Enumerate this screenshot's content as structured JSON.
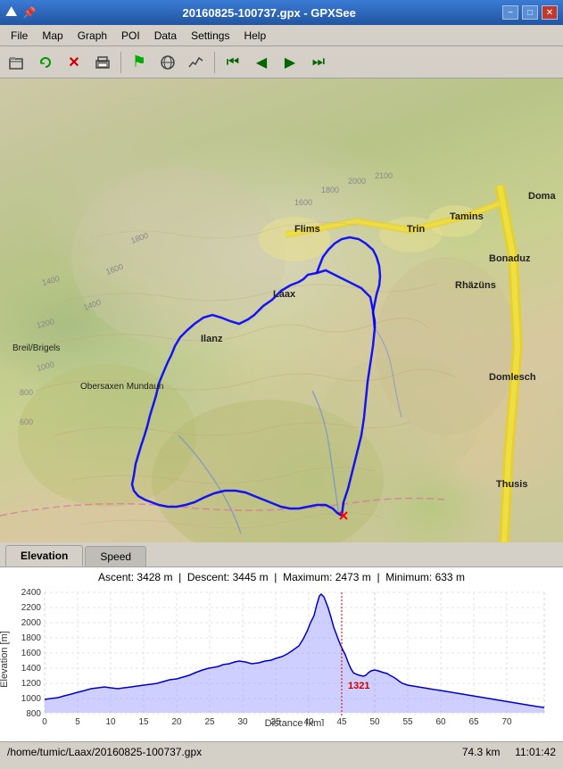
{
  "titlebar": {
    "icon": "⛰",
    "title": "20160825-100737.gpx - GPXSee",
    "minimize": "−",
    "maximize": "□",
    "close": "✕"
  },
  "menu": {
    "items": [
      "File",
      "Map",
      "Graph",
      "POI",
      "Data",
      "Settings",
      "Help"
    ]
  },
  "toolbar": {
    "buttons": [
      {
        "name": "open-button",
        "icon": "🗁",
        "title": "Open"
      },
      {
        "name": "reload-button",
        "icon": "↺",
        "title": "Reload"
      },
      {
        "name": "close-button",
        "icon": "✕",
        "title": "Close"
      },
      {
        "name": "print-button",
        "icon": "🖶",
        "title": "Print"
      },
      {
        "name": "waypoints-button",
        "icon": "⚑",
        "title": "Waypoints"
      },
      {
        "name": "map-button",
        "icon": "🌐",
        "title": "Map"
      },
      {
        "name": "graph-button",
        "icon": "📈",
        "title": "Graph"
      },
      {
        "name": "first-button",
        "icon": "⏮",
        "title": "First"
      },
      {
        "name": "prev-button",
        "icon": "◀",
        "title": "Previous"
      },
      {
        "name": "next-button",
        "icon": "▶",
        "title": "Next"
      },
      {
        "name": "last-button",
        "icon": "⏭",
        "title": "Last"
      }
    ]
  },
  "graph": {
    "elevation_tab": "Elevation",
    "speed_tab": "Speed",
    "info": "Ascent: 3428 m  |  Descent: 3445 m  |  Maximum: 2473 m  |  Minimum: 633 m",
    "ascent": "3428",
    "descent": "3445",
    "maximum": "2473",
    "minimum": "633",
    "y_axis_label": "Elevation [m]",
    "x_axis_label": "Distance [km]",
    "y_values": [
      "2400",
      "2200",
      "2000",
      "1800",
      "1600",
      "1400",
      "1200",
      "1000",
      "800"
    ],
    "x_values": [
      "0",
      "5",
      "10",
      "15",
      "20",
      "25",
      "30",
      "35",
      "40",
      "45",
      "50",
      "55",
      "60",
      "65",
      "70"
    ],
    "marker_value": "1321",
    "marker_x": "45"
  },
  "map": {
    "place_labels": [
      "Flims",
      "Laax",
      "Ilanz",
      "Trin",
      "Tamins",
      "Bonaduz",
      "Rhäzüns",
      "Breil/Brigels",
      "Obersaxen Mundaun",
      "Domlesch",
      "Thusis",
      "Doma"
    ]
  },
  "statusbar": {
    "filepath": "/home/tumic/Laax/20160825-100737.gpx",
    "distance": "74.3 km",
    "time": "11:01:42"
  }
}
